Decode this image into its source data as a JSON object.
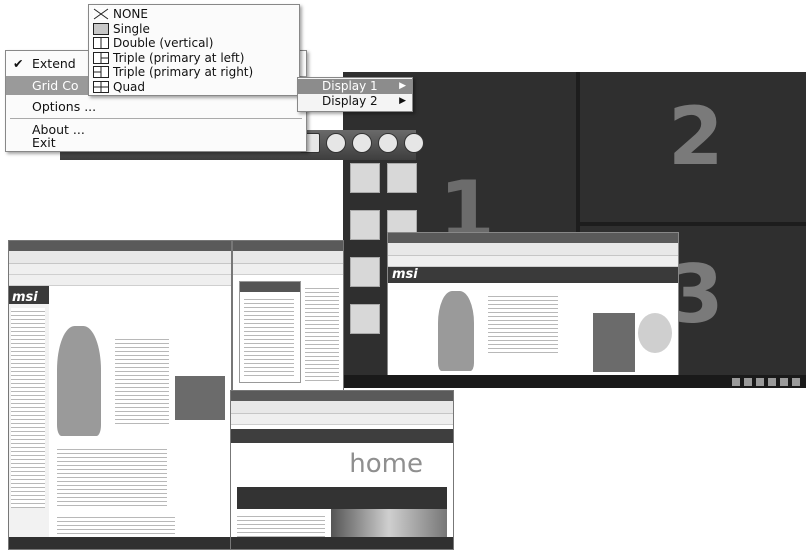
{
  "context_menu": {
    "items": [
      {
        "label": "Extend",
        "checked": true
      },
      {
        "label": "Grid Control",
        "visible_label": "Grid Co",
        "highlighted": true
      },
      {
        "label": "Options ..."
      },
      {
        "label": "About ..."
      },
      {
        "label": "Exit"
      }
    ],
    "check_glyph": "✔"
  },
  "grid_submenu": {
    "items": [
      {
        "label": "NONE",
        "icon": "none-grid-icon"
      },
      {
        "label": "Single",
        "icon": "single-grid-icon"
      },
      {
        "label": "Double (vertical)",
        "icon": "double-vertical-grid-icon"
      },
      {
        "label": "Triple (primary at left)",
        "icon": "triple-left-grid-icon"
      },
      {
        "label": "Triple (primary at right)",
        "icon": "triple-right-grid-icon"
      },
      {
        "label": "Quad",
        "icon": "quad-grid-icon"
      }
    ]
  },
  "display_submenu": {
    "items": [
      {
        "label": "Display 1",
        "highlighted": true
      },
      {
        "label": "Display 2",
        "highlighted": false
      }
    ],
    "arrow_glyph": "▶"
  },
  "desktop_preview": {
    "zone_numbers": [
      "1",
      "2",
      "3"
    ]
  },
  "colors": {
    "menu_highlight": "#9a9a9a",
    "desktop_bg": "#2f2f2f",
    "zone_number": "#7a7a7a"
  }
}
